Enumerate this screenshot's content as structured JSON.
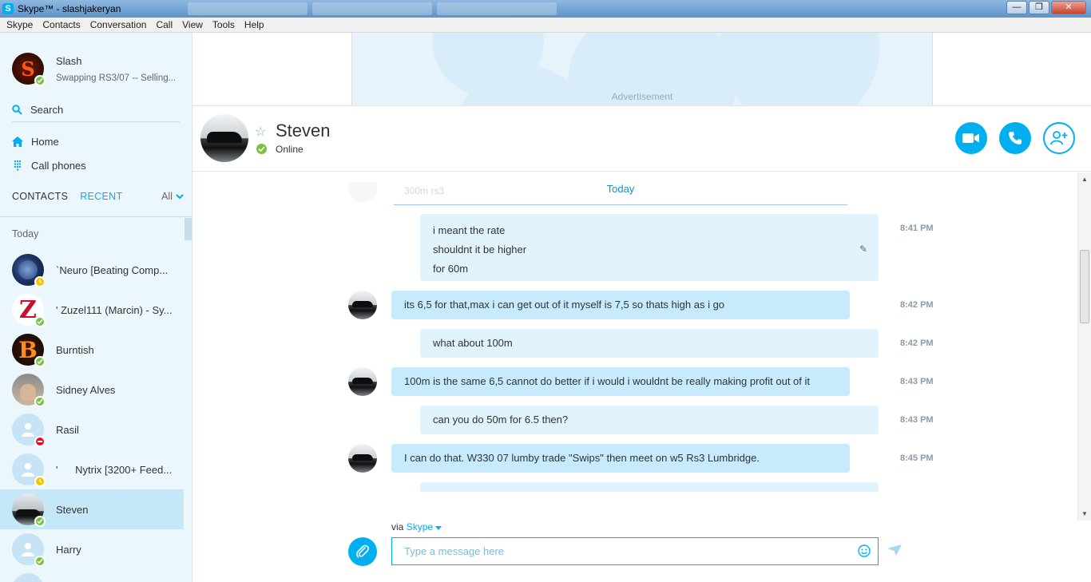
{
  "window": {
    "title": "Skype™ - slashjakeryan",
    "controls": [
      "minimize",
      "maximize",
      "close"
    ]
  },
  "menu": [
    "Skype",
    "Contacts",
    "Conversation",
    "Call",
    "View",
    "Tools",
    "Help"
  ],
  "profile": {
    "name": "Slash",
    "mood": "Swapping RS3/07 -- Selling...",
    "status": "online",
    "avatar_letter": "S"
  },
  "sidebar": {
    "search_label": "Search",
    "nav": [
      {
        "label": "Home",
        "icon": "home-icon"
      },
      {
        "label": "Call phones",
        "icon": "dialpad-icon"
      }
    ],
    "tabs": {
      "contacts": "CONTACTS",
      "recent": "RECENT",
      "filter": "All"
    },
    "section_label": "Today",
    "contacts": [
      {
        "name": "`Neuro [Beating Comp...",
        "status": "away",
        "selected": false
      },
      {
        "name": "' Zuzel111 (Marcin) - Sy...",
        "status": "online",
        "selected": false
      },
      {
        "name": "Burntish",
        "status": "online",
        "selected": false
      },
      {
        "name": "Sidney Alves",
        "status": "online",
        "selected": false
      },
      {
        "name": "Rasil",
        "status": "dnd",
        "selected": false
      },
      {
        "name": "'      Nytrix [3200+ Feed...",
        "status": "away",
        "selected": false
      },
      {
        "name": "Steven",
        "status": "online",
        "selected": true
      },
      {
        "name": "Harry",
        "status": "online",
        "selected": false
      }
    ]
  },
  "ad": {
    "label": "Advertisement"
  },
  "conversation": {
    "name": "Steven",
    "status": "Online",
    "actions": [
      "video-call",
      "voice-call",
      "add-people"
    ],
    "date_separator": "Today",
    "ghost_text": "300m rs3",
    "messages": [
      {
        "dir": "out",
        "lines": [
          "i meant the rate",
          "shouldnt it be higher",
          "for 60m"
        ],
        "time": "8:41 PM",
        "edited": true
      },
      {
        "dir": "in",
        "lines": [
          "its 6,5 for that,max i can get out of it myself is 7,5 so thats high as i go"
        ],
        "time": "8:42 PM"
      },
      {
        "dir": "out",
        "lines": [
          "what about 100m"
        ],
        "time": "8:42 PM"
      },
      {
        "dir": "in",
        "lines": [
          "100m is the same 6,5 cannot do better if i would i wouldnt be really making profit out of it"
        ],
        "time": "8:43 PM"
      },
      {
        "dir": "out",
        "lines": [
          "can you do 50m for 6.5 then?"
        ],
        "time": "8:43 PM"
      },
      {
        "dir": "in",
        "lines": [
          "I can do that. W330 07 lumby trade \"Swips\" then meet on w5 Rs3 Lumbridge."
        ],
        "time": "8:45 PM"
      }
    ]
  },
  "compose": {
    "via": "via",
    "via_service": "Skype",
    "placeholder": "Type a message here"
  },
  "colors": {
    "accent": "#00aff0",
    "online": "#7ac143",
    "away": "#f8c300",
    "dnd": "#e81123",
    "sidebar_bg": "#ecf6fd",
    "bubble_in": "#c7ebfc",
    "bubble_out": "#e1f4fd"
  }
}
